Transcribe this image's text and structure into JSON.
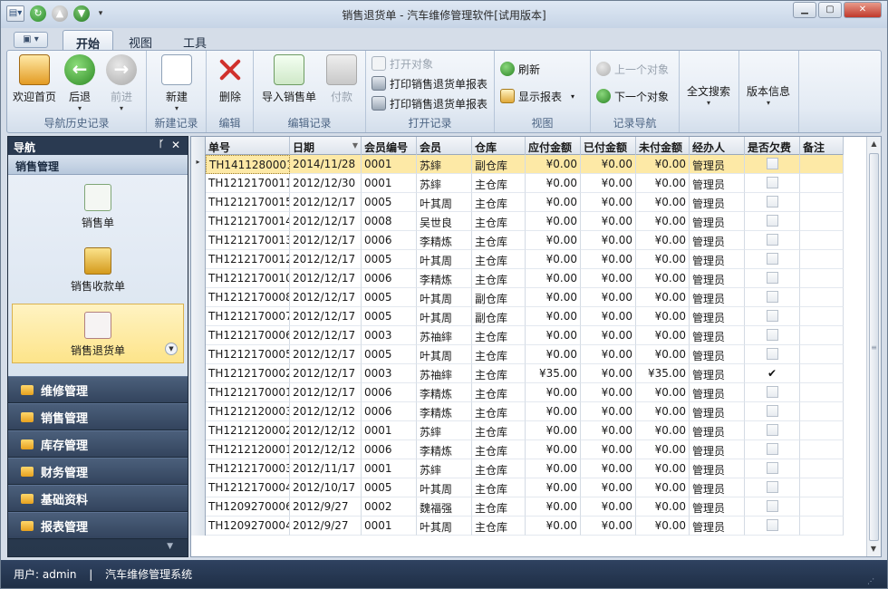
{
  "window": {
    "title": "销售退货单 - 汽车维修管理软件[试用版本]"
  },
  "quick_access": {
    "icons": [
      "app-menu-icon",
      "refresh-icon",
      "back-icon",
      "forward-icon",
      "customize-icon"
    ]
  },
  "ribbon_tabs": [
    {
      "label": "开始",
      "active": true
    },
    {
      "label": "视图",
      "active": false
    },
    {
      "label": "工具",
      "active": false
    }
  ],
  "ribbon": {
    "nav_history": {
      "label": "导航历史记录",
      "home": "欢迎首页",
      "back": "后退",
      "forward": "前进"
    },
    "new_record": {
      "label": "新建记录",
      "new": "新建"
    },
    "edit": {
      "label": "编辑",
      "delete": "删除"
    },
    "edit_record": {
      "label": "编辑记录",
      "import_sales": "导入销售单",
      "pay": "付款"
    },
    "open_record": {
      "label": "打开记录",
      "open_object": "打开对象",
      "print_return_report1": "打印销售退货单报表",
      "print_return_report2": "打印销售退货单报表"
    },
    "view": {
      "label": "视图",
      "refresh": "刷新",
      "show_report": "显示报表"
    },
    "record_nav": {
      "label": "记录导航",
      "prev": "上一个对象",
      "next": "下一个对象"
    },
    "search": {
      "label": "全文搜索"
    },
    "version": {
      "label": "版本信息"
    }
  },
  "nav": {
    "title": "导航",
    "section": "销售管理",
    "items": [
      {
        "label": "销售单",
        "selected": false
      },
      {
        "label": "销售收款单",
        "selected": false
      },
      {
        "label": "销售退货单",
        "selected": true
      }
    ],
    "groups": [
      "维修管理",
      "销售管理",
      "库存管理",
      "财务管理",
      "基础资料",
      "报表管理"
    ]
  },
  "grid": {
    "columns": [
      "单号",
      "日期",
      "会员编号",
      "会员",
      "仓库",
      "应付金额",
      "已付金额",
      "未付金额",
      "经办人",
      "是否欠费",
      "备注"
    ],
    "rows": [
      [
        "TH1411280001",
        "2014/11/28",
        "0001",
        "苏繂",
        "副仓库",
        "¥0.00",
        "¥0.00",
        "¥0.00",
        "管理员",
        false,
        ""
      ],
      [
        "TH1212170011",
        "2012/12/30",
        "0001",
        "苏繂",
        "主仓库",
        "¥0.00",
        "¥0.00",
        "¥0.00",
        "管理员",
        false,
        ""
      ],
      [
        "TH1212170015",
        "2012/12/17",
        "0005",
        "叶其周",
        "主仓库",
        "¥0.00",
        "¥0.00",
        "¥0.00",
        "管理员",
        false,
        ""
      ],
      [
        "TH1212170014",
        "2012/12/17",
        "0008",
        "吴世良",
        "主仓库",
        "¥0.00",
        "¥0.00",
        "¥0.00",
        "管理员",
        false,
        ""
      ],
      [
        "TH1212170013",
        "2012/12/17",
        "0006",
        "李精炼",
        "主仓库",
        "¥0.00",
        "¥0.00",
        "¥0.00",
        "管理员",
        false,
        ""
      ],
      [
        "TH1212170012",
        "2012/12/17",
        "0005",
        "叶其周",
        "主仓库",
        "¥0.00",
        "¥0.00",
        "¥0.00",
        "管理员",
        false,
        ""
      ],
      [
        "TH1212170010",
        "2012/12/17",
        "0006",
        "李精炼",
        "主仓库",
        "¥0.00",
        "¥0.00",
        "¥0.00",
        "管理员",
        false,
        ""
      ],
      [
        "TH1212170008",
        "2012/12/17",
        "0005",
        "叶其周",
        "副仓库",
        "¥0.00",
        "¥0.00",
        "¥0.00",
        "管理员",
        false,
        ""
      ],
      [
        "TH1212170007",
        "2012/12/17",
        "0005",
        "叶其周",
        "副仓库",
        "¥0.00",
        "¥0.00",
        "¥0.00",
        "管理员",
        false,
        ""
      ],
      [
        "TH1212170006",
        "2012/12/17",
        "0003",
        "苏䄂繂",
        "主仓库",
        "¥0.00",
        "¥0.00",
        "¥0.00",
        "管理员",
        false,
        ""
      ],
      [
        "TH1212170005",
        "2012/12/17",
        "0005",
        "叶其周",
        "主仓库",
        "¥0.00",
        "¥0.00",
        "¥0.00",
        "管理员",
        false,
        ""
      ],
      [
        "TH1212170002",
        "2012/12/17",
        "0003",
        "苏䄂繂",
        "主仓库",
        "¥35.00",
        "¥0.00",
        "¥35.00",
        "管理员",
        true,
        ""
      ],
      [
        "TH1212170001",
        "2012/12/17",
        "0006",
        "李精炼",
        "主仓库",
        "¥0.00",
        "¥0.00",
        "¥0.00",
        "管理员",
        false,
        ""
      ],
      [
        "TH1212120003",
        "2012/12/12",
        "0006",
        "李精炼",
        "主仓库",
        "¥0.00",
        "¥0.00",
        "¥0.00",
        "管理员",
        false,
        ""
      ],
      [
        "TH1212120002",
        "2012/12/12",
        "0001",
        "苏繂",
        "主仓库",
        "¥0.00",
        "¥0.00",
        "¥0.00",
        "管理员",
        false,
        ""
      ],
      [
        "TH1212120001",
        "2012/12/12",
        "0006",
        "李精炼",
        "主仓库",
        "¥0.00",
        "¥0.00",
        "¥0.00",
        "管理员",
        false,
        ""
      ],
      [
        "TH1212170003",
        "2012/11/17",
        "0001",
        "苏繂",
        "主仓库",
        "¥0.00",
        "¥0.00",
        "¥0.00",
        "管理员",
        false,
        ""
      ],
      [
        "TH1212170004",
        "2012/10/17",
        "0005",
        "叶其周",
        "主仓库",
        "¥0.00",
        "¥0.00",
        "¥0.00",
        "管理员",
        false,
        ""
      ],
      [
        "TH1209270006",
        "2012/9/27",
        "0002",
        "魏福强",
        "主仓库",
        "¥0.00",
        "¥0.00",
        "¥0.00",
        "管理员",
        false,
        ""
      ],
      [
        "TH1209270004",
        "2012/9/27",
        "0001",
        "叶其周",
        "主仓库",
        "¥0.00",
        "¥0.00",
        "¥0.00",
        "管理员",
        false,
        ""
      ]
    ],
    "selected_row": 0
  },
  "status": {
    "user": "用户: admin",
    "separator": "|",
    "system": "汽车维修管理系统"
  },
  "colors": {
    "selection": "#fde9a6",
    "nav_dark": "#2f4260",
    "accent_green": "#2c8a2a"
  }
}
